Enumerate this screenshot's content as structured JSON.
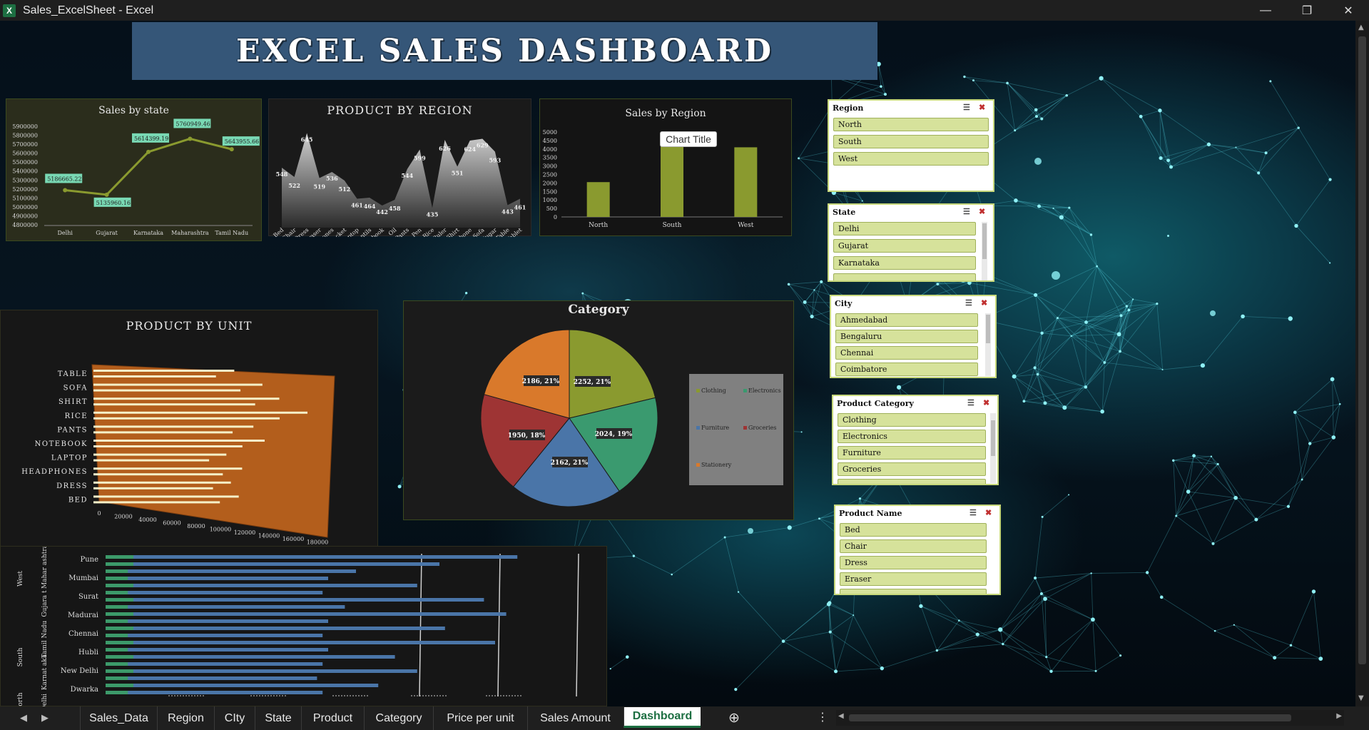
{
  "window": {
    "title": "Sales_ExcelSheet - Excel",
    "app_icon": "excel-icon",
    "controls": [
      "minimize",
      "restore",
      "close"
    ]
  },
  "banner": {
    "title": "EXCEL SALES DASHBOARD"
  },
  "sales_by_state": {
    "title": "Sales by state",
    "categories": [
      "Delhi",
      "Gujarat",
      "Karnataka",
      "Maharashtra",
      "Tamil Nadu"
    ],
    "values": [
      5186665.22,
      5135960.16,
      5614399.19,
      5760949.46,
      5643955.66
    ],
    "labels": [
      "5186665.22",
      "5135960.16",
      "5614399.19",
      "5760949.46",
      "5643955.66"
    ],
    "yticks": [
      "5900000",
      "5800000",
      "5700000",
      "5600000",
      "5500000",
      "5400000",
      "5300000",
      "5200000",
      "5100000",
      "5000000",
      "4900000",
      "4800000"
    ],
    "ylim": [
      4800000,
      5900000
    ]
  },
  "product_by_region": {
    "title": "PRODUCT BY REGION",
    "categories": [
      "Bed",
      "Chair",
      "Dress",
      "Eraser",
      "Headphones",
      "Jacket",
      "Laptop",
      "Lentils",
      "Notebook",
      "Oil",
      "Pants",
      "Pen",
      "Rice",
      "Ruler",
      "Shirt",
      "Smartphone",
      "Sofa",
      "Sugar",
      "Table",
      "Tablet"
    ],
    "values": [
      548,
      522,
      645,
      519,
      536,
      512,
      461,
      464,
      442,
      458,
      544,
      599,
      435,
      626,
      551,
      624,
      629,
      593,
      443,
      461
    ],
    "labels": [
      "548",
      "522",
      "645",
      "519",
      "536",
      "512",
      "461",
      "464",
      "442",
      "458",
      "544",
      "599",
      "435",
      "626",
      "551",
      "624",
      "629",
      "593",
      "443",
      "461"
    ]
  },
  "sales_by_region": {
    "title": "Sales by Region",
    "tooltip": "Chart Title",
    "categories": [
      "North",
      "South",
      "West"
    ],
    "values": [
      2050,
      4300,
      4100
    ],
    "yticks": [
      "5000",
      "4500",
      "4000",
      "3500",
      "3000",
      "2500",
      "2000",
      "1500",
      "1000",
      "500",
      "0"
    ],
    "ylim": [
      0,
      5000
    ],
    "color": "#8a9a2f"
  },
  "product_by_unit": {
    "title": "PRODUCT BY UNIT",
    "categories": [
      "TABLE",
      "SOFA",
      "SHIRT",
      "RICE",
      "PANTS",
      "NOTEBOOK",
      "LAPTOP",
      "HEADPHONES",
      "DRESS",
      "BED"
    ],
    "values": [
      125000,
      150000,
      165000,
      190000,
      142000,
      152000,
      118000,
      132000,
      122000,
      129000
    ],
    "xticks": [
      "0",
      "20000",
      "40000",
      "60000",
      "80000",
      "100000",
      "120000",
      "140000",
      "160000",
      "180000"
    ]
  },
  "category": {
    "title": "Category",
    "slices": [
      {
        "name": "Clothing",
        "label": "2252, 21%",
        "value": 2252,
        "color": "#8a9a2f"
      },
      {
        "name": "Electronics",
        "label": "2024, 19%",
        "value": 2024,
        "color": "#3a9a6f"
      },
      {
        "name": "Furniture",
        "label": "2162, 21%",
        "value": 2162,
        "color": "#4a75a8"
      },
      {
        "name": "Groceries",
        "label": "1950, 18%",
        "value": 1950,
        "color": "#9e3434"
      },
      {
        "name": "Stationery",
        "label": "2186, 21%",
        "value": 2186,
        "color": "#d9792b"
      }
    ]
  },
  "city_chart": {
    "groups": [
      {
        "region": "West",
        "state": "Maharashtra"
      },
      {
        "region": "West",
        "state": "Gujarat"
      },
      {
        "region": "South",
        "state": "Tamil Nadu"
      },
      {
        "region": "South",
        "state": "Karnataka"
      },
      {
        "region": "North",
        "state": "Delhi"
      }
    ],
    "region_labels": [
      "West",
      "South",
      "North"
    ],
    "state_labels": [
      "Mahar ashtra",
      "Gujara t",
      "Tamil Nadu",
      "Karnat aka",
      "Delhi"
    ],
    "cities": [
      "Pune",
      "Mumbai",
      "Surat",
      "Madurai",
      "Chennai",
      "Hubli",
      "New Delhi",
      "Dwarka"
    ],
    "values": [
      0.74,
      0.6,
      0.45,
      0.4,
      0.56,
      0.39,
      0.68,
      0.43,
      0.72,
      0.4,
      0.61,
      0.39,
      0.7,
      0.4,
      0.52,
      0.39,
      0.56,
      0.38,
      0.49,
      0.39
    ],
    "green_values": [
      0.05,
      0.05,
      0.04,
      0.04,
      0.05,
      0.04,
      0.05,
      0.04,
      0.05,
      0.04,
      0.05,
      0.04,
      0.05,
      0.04,
      0.05,
      0.04,
      0.05,
      0.04,
      0.05,
      0.04
    ]
  },
  "slicers": {
    "region": {
      "title": "Region",
      "items": [
        "North",
        "South",
        "West"
      ]
    },
    "state": {
      "title": "State",
      "items": [
        "Delhi",
        "Gujarat",
        "Karnataka"
      ]
    },
    "city": {
      "title": "City",
      "items": [
        "Ahmedabad",
        "Bengaluru",
        "Chennai",
        "Coimbatore"
      ]
    },
    "product_category": {
      "title": "Product Category",
      "items": [
        "Clothing",
        "Electronics",
        "Furniture",
        "Groceries"
      ]
    },
    "product_name": {
      "title": "Product Name",
      "items": [
        "Bed",
        "Chair",
        "Dress",
        "Eraser"
      ]
    }
  },
  "tabs": [
    "Sales_Data",
    "Region",
    "CIty",
    "State",
    "Product",
    "Category",
    "Price per unit",
    "Sales Amount",
    "Dashboard"
  ],
  "active_tab": "Dashboard"
}
